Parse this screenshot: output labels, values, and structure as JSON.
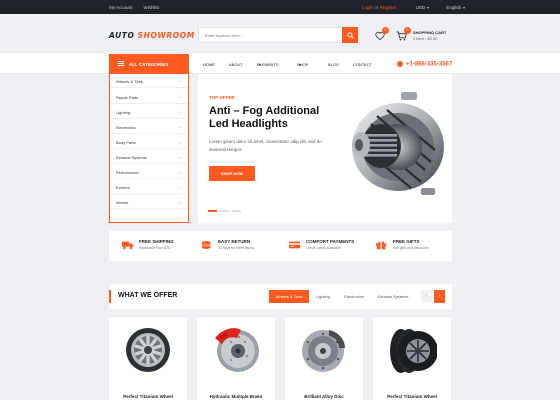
{
  "topbar": {
    "my_account": "My Account",
    "wishlist": "Wishlist",
    "login": "Login",
    "or": "or",
    "register": "Register",
    "currency": "USD",
    "language": "English"
  },
  "header": {
    "logo_part1": "AUTO",
    "logo_part2": "SHOWROOM",
    "search_placeholder": "Enter keyword here...",
    "wishlist_count": "0",
    "cart_count": "0",
    "cart_title": "SHOPPING CART",
    "cart_summary": "0 item - $0.00"
  },
  "nav": {
    "all_categories": "ALL CATEGORIES",
    "items": [
      "HOME",
      "ABOUT",
      "ELEMENTS",
      "SHOP",
      "BLOG",
      "CONTACT"
    ],
    "phone": "+1-888-335-3567"
  },
  "categories": [
    "Wheels & Tires",
    "Repair Parts",
    "Lighting",
    "Electronics",
    "Body Parts",
    "Exhaust Systems",
    "Performance",
    "Exterior",
    "Interior"
  ],
  "hero": {
    "kicker": "TOP OFFER",
    "title": "Anti – Fog Additional Led Headlights",
    "description": "Lorem ipsum dolor sit amet, consectetur odip elit, sed do eiusmod tempor.",
    "cta": "SHOP NOW"
  },
  "features": [
    {
      "title": "FREE SHIPPING",
      "sub": "Worldwide from $75",
      "icon": "truck-icon"
    },
    {
      "title": "EASY RETURN",
      "sub": "30 days for free returns",
      "icon": "coins-icon"
    },
    {
      "title": "COMFORT PAYMENTS",
      "sub": "Credit Cards Available",
      "icon": "credit-card-icon"
    },
    {
      "title": "FREE GIFTS",
      "sub": "Get gifts and discounts",
      "icon": "gift-icon"
    }
  ],
  "offer": {
    "heading": "WHAT WE OFFER",
    "tabs": [
      "Wheels & Tires",
      "Lighting",
      "Electronics",
      "Exhaust Systems"
    ],
    "active_tab": "Wheels & Tires",
    "prev": "‹",
    "next": "›"
  },
  "products": [
    {
      "name": "Perfect Titanium Wheel",
      "icon": "alloy-wheel-icon"
    },
    {
      "name": "Hydraulic Multiple Brake",
      "icon": "brake-caliper-icon"
    },
    {
      "name": "Brilliant Alloy Disc",
      "icon": "brake-disc-icon"
    },
    {
      "name": "Perfect Titanium Wheel",
      "icon": "tire-icon"
    }
  ],
  "colors": {
    "accent": "#ff5a1f",
    "dark": "#1f2329",
    "background": "#eef0f3"
  }
}
